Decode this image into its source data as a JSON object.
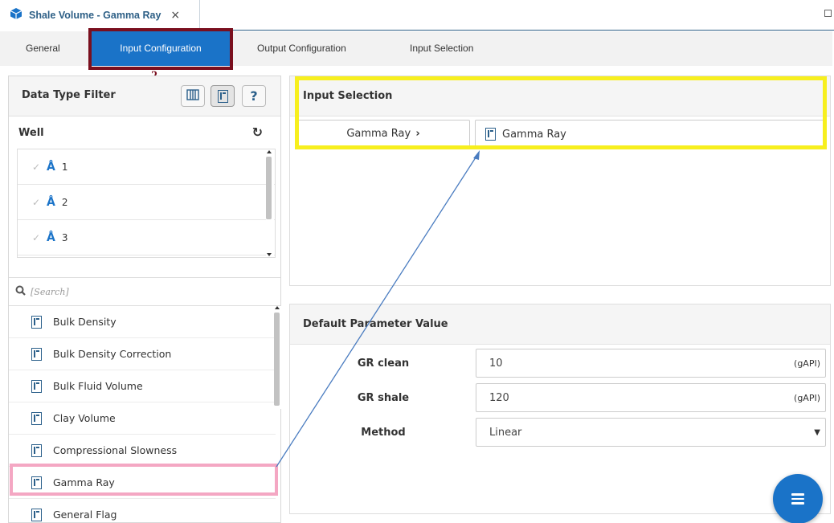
{
  "window": {
    "tab_title": "Shale Volume - Gamma Ray",
    "close_glyph": "×"
  },
  "subtabs": {
    "general": "General",
    "input_configuration": "Input Configuration",
    "output_configuration": "Output Configuration",
    "input_selection": "Input Selection",
    "active": "input_configuration"
  },
  "annotations": {
    "step_number": "2",
    "highlight_colors": {
      "tab": "#7a0f1e",
      "selection": "#f7ef1e",
      "list_item": "#f4a7c3",
      "arrow": "#4a7cc0"
    }
  },
  "data_type_filter": {
    "title": "Data Type Filter",
    "tool_buttons": [
      "columns-icon",
      "document-icon",
      "help-icon"
    ],
    "well_label": "Well",
    "wells": [
      "1",
      "2",
      "3"
    ],
    "search_placeholder": "[Search]",
    "data_types": [
      "Bulk Density",
      "Bulk Density Correction",
      "Bulk Fluid Volume",
      "Clay Volume",
      "Compressional Slowness",
      "Gamma Ray",
      "General Flag"
    ],
    "highlighted_item": "Gamma Ray"
  },
  "input_selection": {
    "title": "Input Selection",
    "input_name": "Gamma Ray",
    "selected_value": "Gamma Ray"
  },
  "default_parameters": {
    "title": "Default Parameter Value",
    "rows": [
      {
        "label": "GR clean",
        "value": "10",
        "unit": "(gAPI)"
      },
      {
        "label": "GR shale",
        "value": "120",
        "unit": "(gAPI)"
      },
      {
        "label": "Method",
        "value": "Linear",
        "unit": ""
      }
    ]
  },
  "colors": {
    "accent": "#1a73c8",
    "brand_text": "#2d5f86"
  }
}
